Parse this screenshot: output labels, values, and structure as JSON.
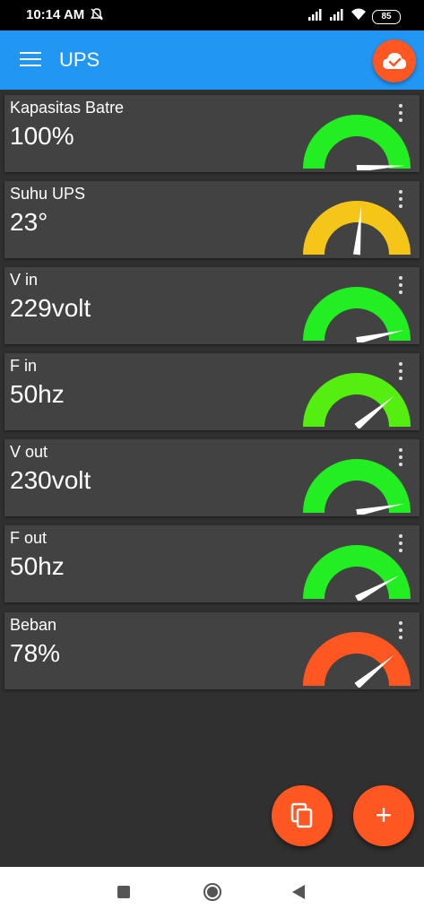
{
  "status_bar": {
    "time": "10:14 AM",
    "battery": "85",
    "icons": [
      "bell-off-icon",
      "signal-icon",
      "signal-icon",
      "wifi-icon",
      "battery-icon"
    ]
  },
  "app_bar": {
    "title": "UPS",
    "color": "#2196f3",
    "menu_icon": "menu-icon",
    "action_icon": "cloud-done-icon",
    "action_color": "#ff5722"
  },
  "cards": [
    {
      "label": "Kapasitas Batre",
      "value": "100%",
      "gauge_color": "#22ee22",
      "gauge_fraction": 0.98
    },
    {
      "label": "Suhu UPS",
      "value": "23°",
      "gauge_color": "#f5c518",
      "gauge_fraction": 0.53
    },
    {
      "label": "V in",
      "value": "229volt",
      "gauge_color": "#22ee22",
      "gauge_fraction": 0.93
    },
    {
      "label": "F in",
      "value": "50hz",
      "gauge_color": "#55ee11",
      "gauge_fraction": 0.78
    },
    {
      "label": "V out",
      "value": "230volt",
      "gauge_color": "#22ee22",
      "gauge_fraction": 0.94
    },
    {
      "label": "F out",
      "value": "50hz",
      "gauge_color": "#22ee22",
      "gauge_fraction": 0.84
    },
    {
      "label": "Beban",
      "value": "78%",
      "gauge_color": "#ff5722",
      "gauge_fraction": 0.78
    }
  ],
  "fabs": [
    {
      "icon": "copy-icon",
      "color": "#ff5722"
    },
    {
      "icon": "plus-icon",
      "label": "+",
      "color": "#ff5722"
    }
  ],
  "nav_bar": {
    "icons": [
      "recents-icon",
      "home-icon",
      "back-icon"
    ]
  }
}
